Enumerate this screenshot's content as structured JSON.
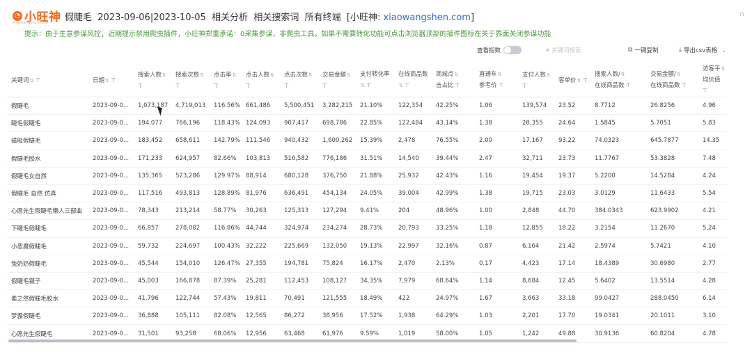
{
  "header": {
    "logo_text": "小旺神",
    "logo_sub": "xiaowangshen.com",
    "title_product": "假睫毛",
    "title_range": "2023-09-06|2023-10-05",
    "title_section": "相关分析",
    "title_tab": "相关搜索词",
    "title_terminal": "所有终端",
    "title_site_prefix": "[小旺神:",
    "title_site_link": "xiaowangshen.com",
    "title_site_suffix": "]"
  },
  "notice": "提示：由于生意参谋风控，近期提示禁用爬虫插件，小旺神郑重承诺：0采集参谋，非爬虫工具，如果不需要转化功能可点击浏览器顶部的插件图标在关于界面关闭参谋功能",
  "toolbar": {
    "view_index_label": "查看指数",
    "search_placeholder": "关键词搜索",
    "copy_label": "一键复制",
    "export_label": "导出csv表格"
  },
  "table": {
    "headers": [
      {
        "line1": "关键词",
        "line2": ""
      },
      {
        "line1": "日期",
        "line2": ""
      },
      {
        "line1": "搜索人数",
        "line2": ""
      },
      {
        "line1": "搜索次数",
        "line2": ""
      },
      {
        "line1": "点击率",
        "line2": ""
      },
      {
        "line1": "点击人数",
        "line2": ""
      },
      {
        "line1": "点击次数",
        "line2": ""
      },
      {
        "line1": "交易金额",
        "line2": ""
      },
      {
        "line1": "支付转化率",
        "line2": ""
      },
      {
        "line1": "在线商品数",
        "line2": ""
      },
      {
        "line1": "商城点",
        "line2": "击占比"
      },
      {
        "line1": "直通车",
        "line2": "参考价"
      },
      {
        "line1": "支付人数",
        "line2": ""
      },
      {
        "line1": "客单价",
        "line2": ""
      },
      {
        "line1": "搜索人数/",
        "line2": "在线商品数"
      },
      {
        "line1": "交易金额/",
        "line2": "在线商品数"
      },
      {
        "line1": "访客平",
        "line2": "均价值"
      }
    ],
    "rows": [
      [
        "假睫毛",
        "2023-09-0...",
        "1,073,187",
        "4,719,013",
        "116.56%",
        "661,486",
        "5,500,451",
        "3,282,215",
        "21.10%",
        "122,354",
        "42.25%",
        "1.06",
        "139,574",
        "23.52",
        "8.7712",
        "26.8256",
        "4.96"
      ],
      [
        "睫毛假睫毛",
        "2023-09-0...",
        "194,077",
        "766,196",
        "118.43%",
        "124,093",
        "907,417",
        "698,786",
        "22.85%",
        "122,484",
        "43.14%",
        "1.38",
        "28,355",
        "24.64",
        "1.5845",
        "5.7051",
        "5.83"
      ],
      [
        "磁吸假睫毛",
        "2023-09-0...",
        "183,452",
        "658,611",
        "142.79%",
        "111,546",
        "940,432",
        "1,600,262",
        "15.39%",
        "2,478",
        "76.55%",
        "2.00",
        "17,167",
        "93.22",
        "74.0323",
        "645.7877",
        "14.35"
      ],
      [
        "假睫毛胶水",
        "2023-09-0...",
        "171,233",
        "624,957",
        "82.66%",
        "103,813",
        "516,582",
        "776,186",
        "31.51%",
        "14,540",
        "39.44%",
        "2.47",
        "32,711",
        "23.73",
        "11.7767",
        "53.3828",
        "7.48"
      ],
      [
        "假睫毛女自然",
        "2023-09-0...",
        "135,365",
        "523,286",
        "129.97%",
        "88,914",
        "680,128",
        "376,750",
        "21.88%",
        "25,932",
        "42.43%",
        "1.16",
        "19,454",
        "19.37",
        "5.2200",
        "14.5284",
        "4.24"
      ],
      [
        "假睫毛 自然 仿真",
        "2023-09-0...",
        "117,516",
        "493,813",
        "128.89%",
        "81,976",
        "636,491",
        "454,134",
        "24.05%",
        "39,004",
        "42.99%",
        "1.38",
        "19,715",
        "23.03",
        "3.0129",
        "11.6433",
        "5.54"
      ],
      [
        "心愿先生假睫毛懒人三部曲",
        "2023-09-0...",
        "78,343",
        "213,214",
        "58.77%",
        "30,263",
        "125,313",
        "127,294",
        "9.41%",
        "204",
        "48.96%",
        "1.00",
        "2,848",
        "44.70",
        "384.0343",
        "623.9902",
        "4.21"
      ],
      [
        "下睫毛假睫毛",
        "2023-09-0...",
        "66,857",
        "278,082",
        "116.86%",
        "44,744",
        "324,974",
        "234,274",
        "28.73%",
        "20,793",
        "33.25%",
        "1.18",
        "12,855",
        "18.22",
        "3.2154",
        "11.2670",
        "5.24"
      ],
      [
        "小恶魔假睫毛",
        "2023-09-0...",
        "59,732",
        "224,697",
        "100.43%",
        "32,222",
        "225,669",
        "132,050",
        "19.13%",
        "22,997",
        "32.16%",
        "0.87",
        "6,164",
        "21.42",
        "2.5974",
        "5.7421",
        "4.10"
      ],
      [
        "兔奶奶假睫毛",
        "2023-09-0...",
        "45,544",
        "154,010",
        "126.47%",
        "27,355",
        "194,781",
        "75,824",
        "16.17%",
        "2,470",
        "2.13%",
        "0.17",
        "4,423",
        "17.14",
        "18.4389",
        "30.6980",
        "2.77"
      ],
      [
        "假睫毛镊子",
        "2023-09-0...",
        "45,003",
        "166,878",
        "87.39%",
        "25,281",
        "112,453",
        "108,127",
        "34.35%",
        "7,979",
        "68.64%",
        "1.14",
        "8,684",
        "12.45",
        "5.6402",
        "13.5514",
        "4.28"
      ],
      [
        "素之然假睫毛胶水",
        "2023-09-0...",
        "41,796",
        "122,744",
        "57.43%",
        "19,811",
        "70,491",
        "121,555",
        "18.49%",
        "422",
        "24.97%",
        "1.67",
        "3,663",
        "33.18",
        "99.0427",
        "288.0450",
        "6.14"
      ],
      [
        "梦露假睫毛",
        "2023-09-0...",
        "36,888",
        "105,111",
        "82.08%",
        "12,565",
        "86,272",
        "38,956",
        "17.52%",
        "1,938",
        "64.29%",
        "1.03",
        "2,201",
        "17.70",
        "19.0341",
        "20.1011",
        "3.10"
      ],
      [
        "心愿先生假睫毛",
        "2023-09-0...",
        "31,501",
        "93,258",
        "68.06%",
        "12,956",
        "63,468",
        "61,976",
        "9.59%",
        "1,019",
        "58.00%",
        "1.05",
        "1,242",
        "49.88",
        "30.9136",
        "60.8204",
        "4.78"
      ]
    ]
  }
}
